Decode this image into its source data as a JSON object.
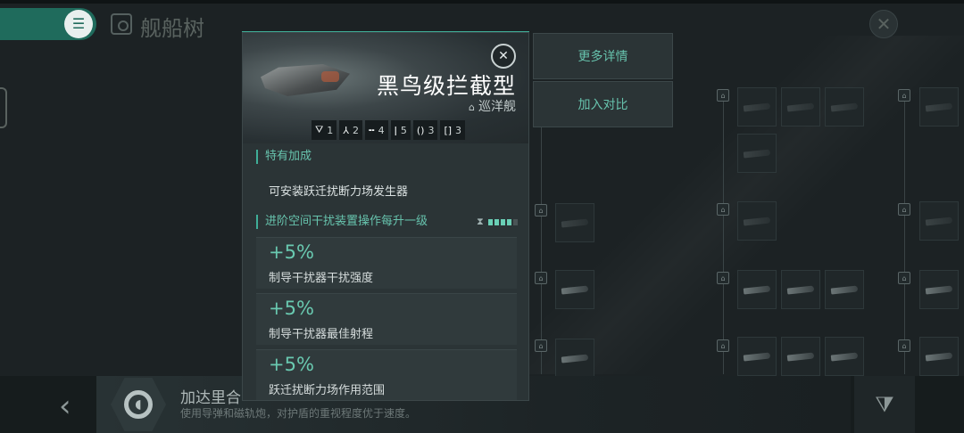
{
  "header": {
    "menu_icon": "menu-icon",
    "title": "舰船树",
    "close_icon": "close-icon"
  },
  "popup": {
    "ship_name": "黑鸟级拦截型",
    "ship_class": "巡洋舰",
    "slots": [
      {
        "icon": "turret-icon",
        "glyph": "⛛",
        "value": "1"
      },
      {
        "icon": "launcher-icon",
        "glyph": "⅄",
        "value": "2"
      },
      {
        "icon": "high-slot-icon",
        "glyph": "╍",
        "value": "4"
      },
      {
        "icon": "mid-slot-icon",
        "glyph": "ǀ",
        "value": "5"
      },
      {
        "icon": "low-slot-icon",
        "glyph": "()",
        "value": "3"
      },
      {
        "icon": "rig-slot-icon",
        "glyph": "[]",
        "value": "3"
      }
    ],
    "special_section_title": "特有加成",
    "special_bonus": "可安装跃迁扰断力场发生器",
    "skill_section_title": "进阶空间干扰装置操作每升一级",
    "skill_level": 4,
    "skill_max": 5,
    "bonuses": [
      {
        "value": "+5%",
        "label": "制导干扰器干扰强度"
      },
      {
        "value": "+5%",
        "label": "制导干扰器最佳射程"
      },
      {
        "value": "+5%",
        "label": "跃迁扰断力场作用范围"
      }
    ]
  },
  "actions": {
    "more_details": "更多详情",
    "add_compare": "加入对比"
  },
  "bottom": {
    "faction_name": "加达里合",
    "faction_desc": "使用导弹和磁轨炮，对护盾的重视程度优于速度。"
  }
}
